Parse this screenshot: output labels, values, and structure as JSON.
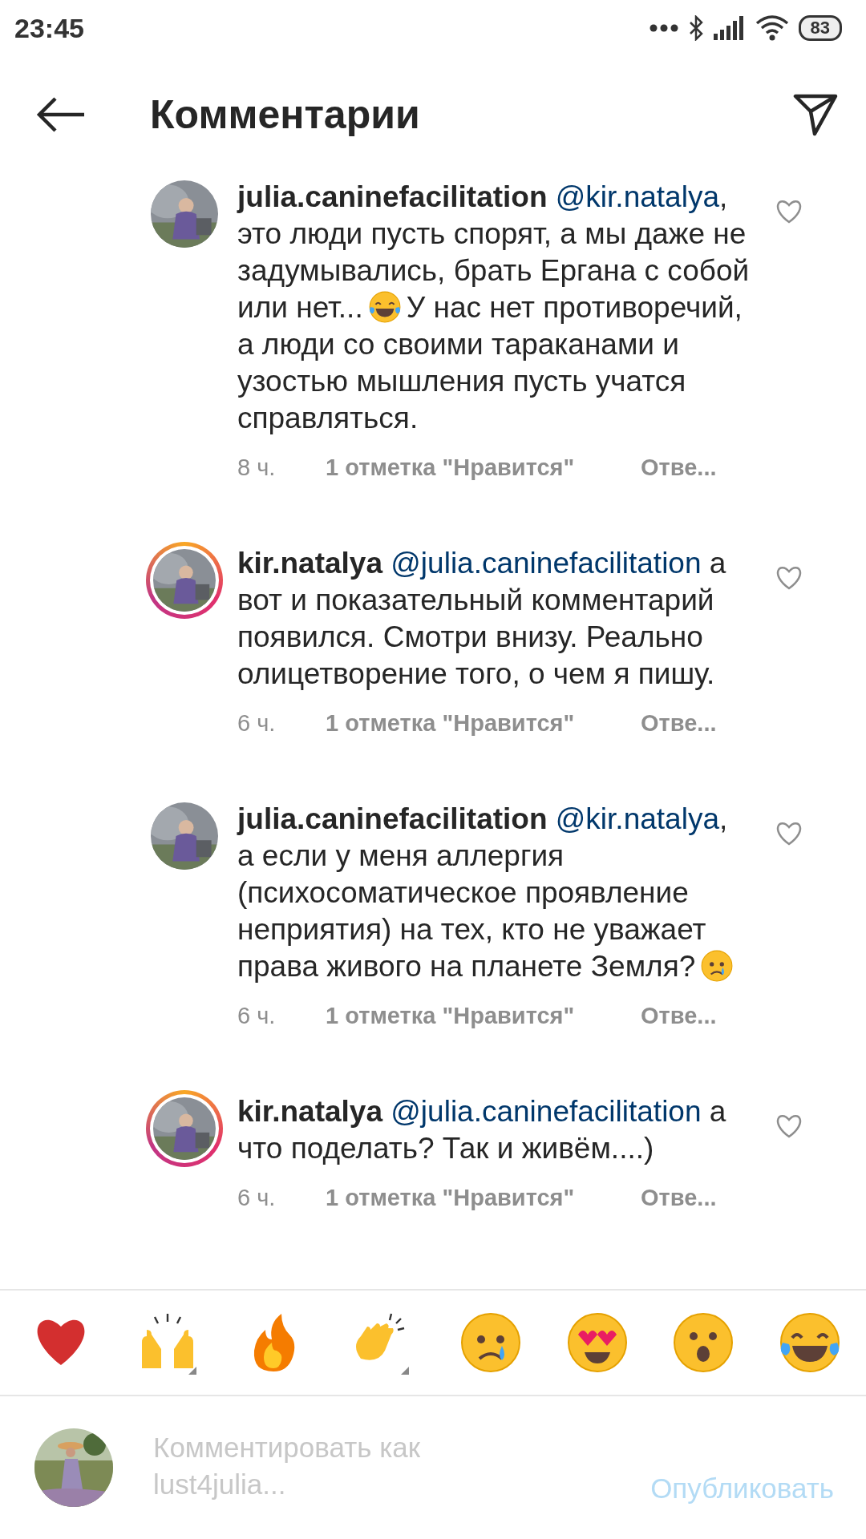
{
  "status_bar": {
    "time": "23:45",
    "battery": "83"
  },
  "header": {
    "title": "Комментарии"
  },
  "comments": [
    {
      "username": "julia.caninefacilitation",
      "mention": "@kir.natalya",
      "story_ring": false,
      "body": [
        {
          "kind": "text",
          "text": ", это люди пусть спорят, а мы даже не задумывались, брать Ергана с собой или нет..."
        },
        {
          "kind": "laughing"
        },
        {
          "kind": "text",
          "text": "У нас нет противоречий, а люди со своими тараканами и узостью мышления пусть учатся справляться."
        }
      ],
      "time": "8 ч.",
      "likes": "1 отметка \"Нравится\"",
      "reply": "Отве..."
    },
    {
      "username": "kir.natalya",
      "mention": "@julia.caninefacilitation",
      "story_ring": true,
      "body": [
        {
          "kind": "text",
          "text": "а вот и показательный комментарий появился. Смотри внизу. Реально олицетворение того, о чем я пишу."
        }
      ],
      "time": "6 ч.",
      "likes": "1 отметка \"Нравится\"",
      "reply": "Отве..."
    },
    {
      "username": "julia.caninefacilitation",
      "mention": "@kir.natalya",
      "story_ring": false,
      "body": [
        {
          "kind": "text",
          "text": ", а если у меня аллергия (психосоматическое проявление неприятия) на тех, кто не уважает права живого на планете Земля?"
        },
        {
          "kind": "crying"
        }
      ],
      "time": "6 ч.",
      "likes": "1 отметка \"Нравится\"",
      "reply": "Отве..."
    },
    {
      "username": "kir.natalya",
      "mention": "@julia.caninefacilitation",
      "story_ring": true,
      "body": [
        {
          "kind": "text",
          "text": "а что поделать? Так и живём....)"
        }
      ],
      "time": "6 ч.",
      "likes": "1 отметка \"Нравится\"",
      "reply": "Отве..."
    }
  ],
  "composer": {
    "placeholder": "Комментировать как lust4julia...",
    "post_button": "Опубликовать",
    "post_disabled": true
  }
}
